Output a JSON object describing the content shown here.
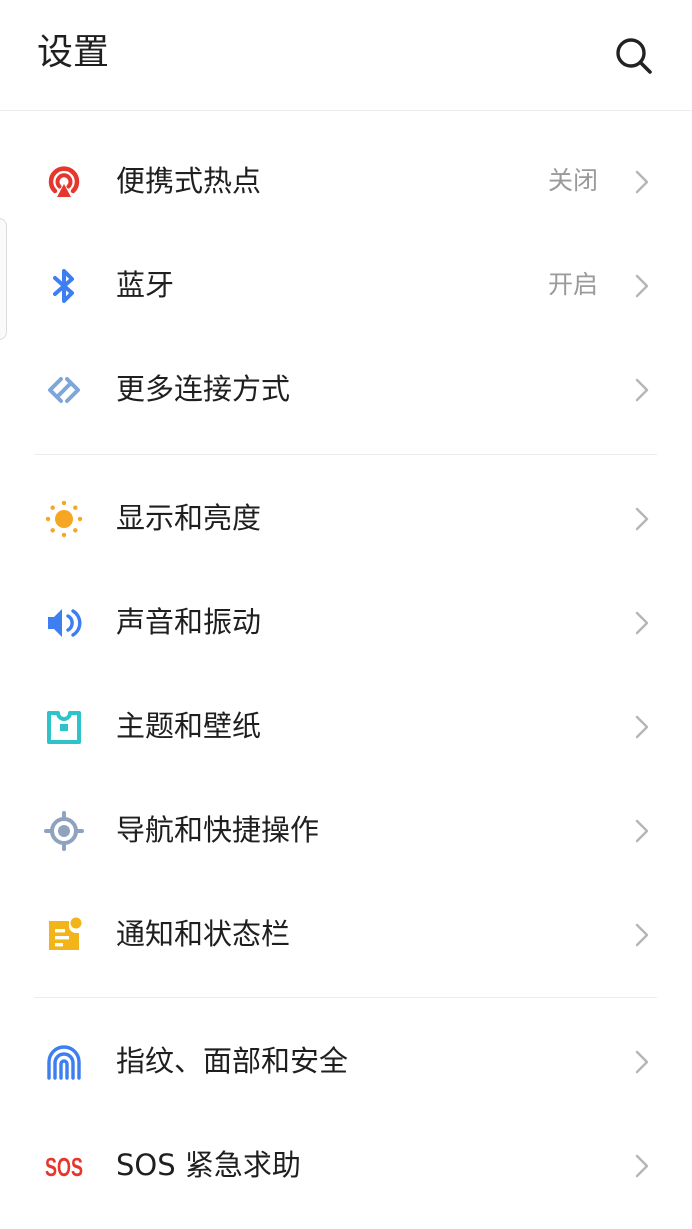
{
  "header": {
    "title": "设置"
  },
  "groups": [
    {
      "items": [
        {
          "label": "便携式热点",
          "value": "关闭",
          "icon": "hotspot-icon"
        },
        {
          "label": "蓝牙",
          "value": "开启",
          "icon": "bluetooth-icon"
        },
        {
          "label": "更多连接方式",
          "icon": "connection-icon"
        }
      ]
    },
    {
      "items": [
        {
          "label": "显示和亮度",
          "icon": "sun-icon"
        },
        {
          "label": "声音和振动",
          "icon": "speaker-icon"
        },
        {
          "label": "主题和壁纸",
          "icon": "theme-icon"
        },
        {
          "label": "导航和快捷操作",
          "icon": "navigation-icon"
        },
        {
          "label": "通知和状态栏",
          "icon": "notification-icon"
        }
      ]
    },
    {
      "items": [
        {
          "label": "指纹、面部和安全",
          "icon": "fingerprint-icon"
        },
        {
          "label": "SOS 紧急求助",
          "icon": "sos-icon",
          "icon_text": "SOS"
        }
      ]
    }
  ],
  "colors": {
    "hotspot": "#e5372d",
    "bluetooth": "#3d7ef0",
    "connection": "#7fa6d9",
    "sun": "#f5a623",
    "speaker": "#3d7ef0",
    "theme": "#2ec3c9",
    "navigation": "#8fa3bf",
    "notification": "#f2b418",
    "fingerprint": "#3d7ef0",
    "sos": "#e5372d"
  }
}
